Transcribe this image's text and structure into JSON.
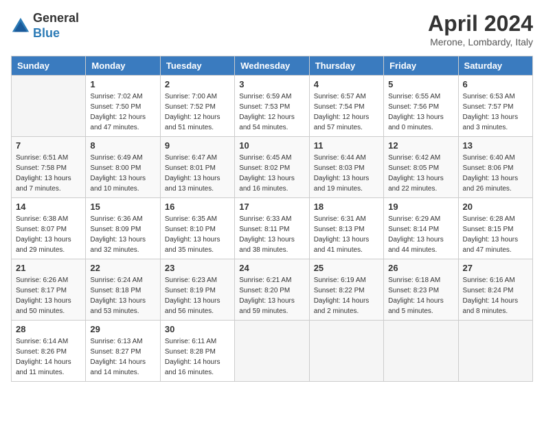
{
  "header": {
    "logo_general": "General",
    "logo_blue": "Blue",
    "title": "April 2024",
    "subtitle": "Merone, Lombardy, Italy"
  },
  "columns": [
    "Sunday",
    "Monday",
    "Tuesday",
    "Wednesday",
    "Thursday",
    "Friday",
    "Saturday"
  ],
  "weeks": [
    [
      {
        "day": "",
        "info": ""
      },
      {
        "day": "1",
        "info": "Sunrise: 7:02 AM\nSunset: 7:50 PM\nDaylight: 12 hours\nand 47 minutes."
      },
      {
        "day": "2",
        "info": "Sunrise: 7:00 AM\nSunset: 7:52 PM\nDaylight: 12 hours\nand 51 minutes."
      },
      {
        "day": "3",
        "info": "Sunrise: 6:59 AM\nSunset: 7:53 PM\nDaylight: 12 hours\nand 54 minutes."
      },
      {
        "day": "4",
        "info": "Sunrise: 6:57 AM\nSunset: 7:54 PM\nDaylight: 12 hours\nand 57 minutes."
      },
      {
        "day": "5",
        "info": "Sunrise: 6:55 AM\nSunset: 7:56 PM\nDaylight: 13 hours\nand 0 minutes."
      },
      {
        "day": "6",
        "info": "Sunrise: 6:53 AM\nSunset: 7:57 PM\nDaylight: 13 hours\nand 3 minutes."
      }
    ],
    [
      {
        "day": "7",
        "info": "Sunrise: 6:51 AM\nSunset: 7:58 PM\nDaylight: 13 hours\nand 7 minutes."
      },
      {
        "day": "8",
        "info": "Sunrise: 6:49 AM\nSunset: 8:00 PM\nDaylight: 13 hours\nand 10 minutes."
      },
      {
        "day": "9",
        "info": "Sunrise: 6:47 AM\nSunset: 8:01 PM\nDaylight: 13 hours\nand 13 minutes."
      },
      {
        "day": "10",
        "info": "Sunrise: 6:45 AM\nSunset: 8:02 PM\nDaylight: 13 hours\nand 16 minutes."
      },
      {
        "day": "11",
        "info": "Sunrise: 6:44 AM\nSunset: 8:03 PM\nDaylight: 13 hours\nand 19 minutes."
      },
      {
        "day": "12",
        "info": "Sunrise: 6:42 AM\nSunset: 8:05 PM\nDaylight: 13 hours\nand 22 minutes."
      },
      {
        "day": "13",
        "info": "Sunrise: 6:40 AM\nSunset: 8:06 PM\nDaylight: 13 hours\nand 26 minutes."
      }
    ],
    [
      {
        "day": "14",
        "info": "Sunrise: 6:38 AM\nSunset: 8:07 PM\nDaylight: 13 hours\nand 29 minutes."
      },
      {
        "day": "15",
        "info": "Sunrise: 6:36 AM\nSunset: 8:09 PM\nDaylight: 13 hours\nand 32 minutes."
      },
      {
        "day": "16",
        "info": "Sunrise: 6:35 AM\nSunset: 8:10 PM\nDaylight: 13 hours\nand 35 minutes."
      },
      {
        "day": "17",
        "info": "Sunrise: 6:33 AM\nSunset: 8:11 PM\nDaylight: 13 hours\nand 38 minutes."
      },
      {
        "day": "18",
        "info": "Sunrise: 6:31 AM\nSunset: 8:13 PM\nDaylight: 13 hours\nand 41 minutes."
      },
      {
        "day": "19",
        "info": "Sunrise: 6:29 AM\nSunset: 8:14 PM\nDaylight: 13 hours\nand 44 minutes."
      },
      {
        "day": "20",
        "info": "Sunrise: 6:28 AM\nSunset: 8:15 PM\nDaylight: 13 hours\nand 47 minutes."
      }
    ],
    [
      {
        "day": "21",
        "info": "Sunrise: 6:26 AM\nSunset: 8:17 PM\nDaylight: 13 hours\nand 50 minutes."
      },
      {
        "day": "22",
        "info": "Sunrise: 6:24 AM\nSunset: 8:18 PM\nDaylight: 13 hours\nand 53 minutes."
      },
      {
        "day": "23",
        "info": "Sunrise: 6:23 AM\nSunset: 8:19 PM\nDaylight: 13 hours\nand 56 minutes."
      },
      {
        "day": "24",
        "info": "Sunrise: 6:21 AM\nSunset: 8:20 PM\nDaylight: 13 hours\nand 59 minutes."
      },
      {
        "day": "25",
        "info": "Sunrise: 6:19 AM\nSunset: 8:22 PM\nDaylight: 14 hours\nand 2 minutes."
      },
      {
        "day": "26",
        "info": "Sunrise: 6:18 AM\nSunset: 8:23 PM\nDaylight: 14 hours\nand 5 minutes."
      },
      {
        "day": "27",
        "info": "Sunrise: 6:16 AM\nSunset: 8:24 PM\nDaylight: 14 hours\nand 8 minutes."
      }
    ],
    [
      {
        "day": "28",
        "info": "Sunrise: 6:14 AM\nSunset: 8:26 PM\nDaylight: 14 hours\nand 11 minutes."
      },
      {
        "day": "29",
        "info": "Sunrise: 6:13 AM\nSunset: 8:27 PM\nDaylight: 14 hours\nand 14 minutes."
      },
      {
        "day": "30",
        "info": "Sunrise: 6:11 AM\nSunset: 8:28 PM\nDaylight: 14 hours\nand 16 minutes."
      },
      {
        "day": "",
        "info": ""
      },
      {
        "day": "",
        "info": ""
      },
      {
        "day": "",
        "info": ""
      },
      {
        "day": "",
        "info": ""
      }
    ]
  ]
}
